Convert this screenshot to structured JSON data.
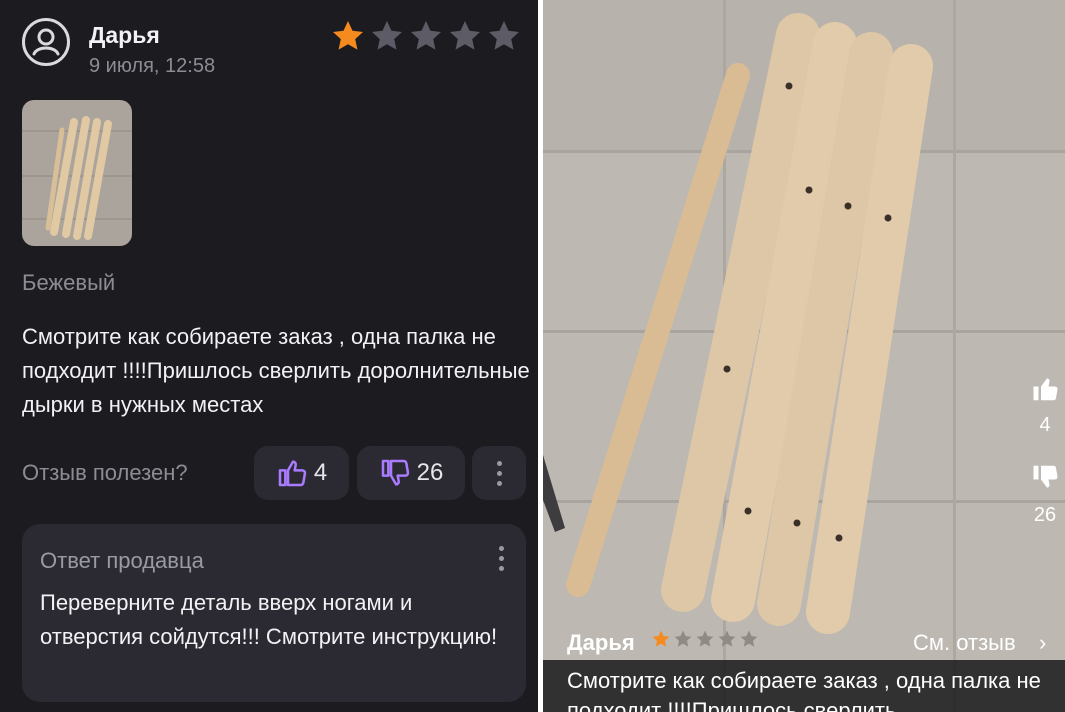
{
  "review": {
    "author": "Дарья",
    "date": "9 июля, 12:58",
    "rating": 1,
    "max_rating": 5,
    "variant": "Бежевый",
    "text": "Смотрите как собираете заказ , одна палка не подходит !!!!Пришлось сверлить доролнительные дырки в нужных местах",
    "helpful_label": "Отзыв полезен?",
    "likes": "4",
    "dislikes": "26"
  },
  "seller_reply": {
    "title": "Ответ продавца",
    "text": "Переверните деталь вверх ногами и отверстия сойдутся!!! Смотрите инструкцию!"
  },
  "overlay": {
    "author": "Дарья",
    "link": "См. отзыв",
    "chevron": "›",
    "text": "Смотрите как собираете заказ , одна палка не подходит !!!!Пришлось сверлить",
    "likes": "4",
    "dislikes": "26"
  },
  "icons": [
    "user-avatar-icon",
    "star-icon",
    "thumbs-up-icon",
    "thumbs-down-icon",
    "more-vertical-icon",
    "chevron-right-icon"
  ],
  "colors": {
    "background": "#1b1b20",
    "card": "#2b2a33",
    "star_active": "#f58b1f",
    "star_inactive": "#5d5c66",
    "accent_purple": "#a97bff"
  }
}
